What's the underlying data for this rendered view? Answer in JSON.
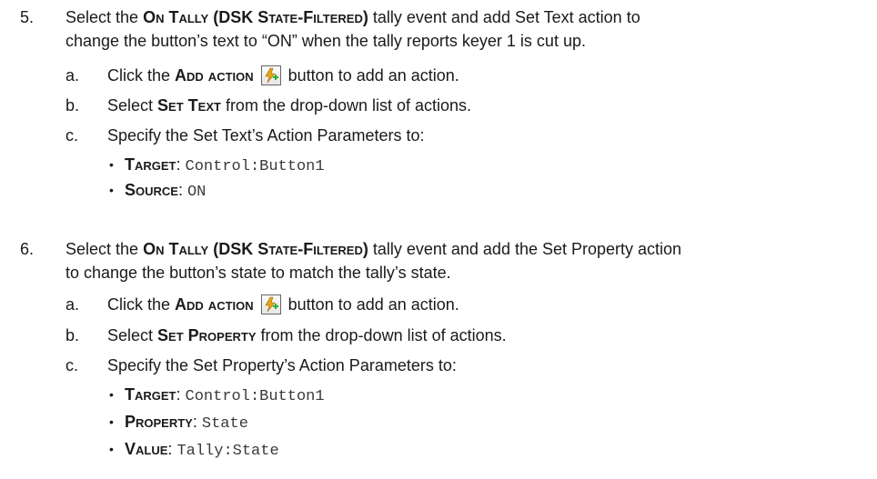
{
  "step5": {
    "num": "5.",
    "line1_pre": "Select the ",
    "line1_bold": "On Tally (DSK State-Filtered)",
    "line1_post": " tally event and add Set Text action to",
    "line2": "change the button’s text to “ON” when the tally reports keyer 1 is cut up.",
    "a": {
      "letter": "a.",
      "pre": "Click the ",
      "bold": "Add action",
      "post": " button to add an action."
    },
    "b": {
      "letter": "b.",
      "pre": "Select ",
      "bold": "Set Text",
      "post": " from the drop-down list of actions."
    },
    "c": {
      "letter": "c.",
      "text": "Specify the Set Text’s Action Parameters to:"
    },
    "bullets": [
      {
        "label": "Target",
        "value": "Control:Button1"
      },
      {
        "label": "Source",
        "value": "ON"
      }
    ]
  },
  "step6": {
    "num": "6.",
    "line1_pre": "Select the ",
    "line1_bold": "On Tally (DSK State-Filtered)",
    "line1_post": " tally event and add the Set Property action",
    "line2": "to change the button’s state to match the tally’s state.",
    "a": {
      "letter": "a.",
      "pre": "Click the ",
      "bold": "Add action",
      "post": " button to add an action."
    },
    "b": {
      "letter": "b.",
      "pre": "Select ",
      "bold": "Set Property",
      "post": " from the drop-down list of actions."
    },
    "c": {
      "letter": "c.",
      "text": "Specify the Set Property’s Action Parameters to:"
    },
    "bullets": [
      {
        "label": "Target",
        "value": "Control:Button1"
      },
      {
        "label": "Property",
        "value": "State"
      },
      {
        "label": "Value",
        "value": "Tally:State"
      }
    ]
  },
  "bullet_glyph": "•",
  "separator": ":",
  "icon": {
    "name": "add-action-icon",
    "bolt_color": "#e8a317",
    "plus_color": "#2eae2e"
  }
}
